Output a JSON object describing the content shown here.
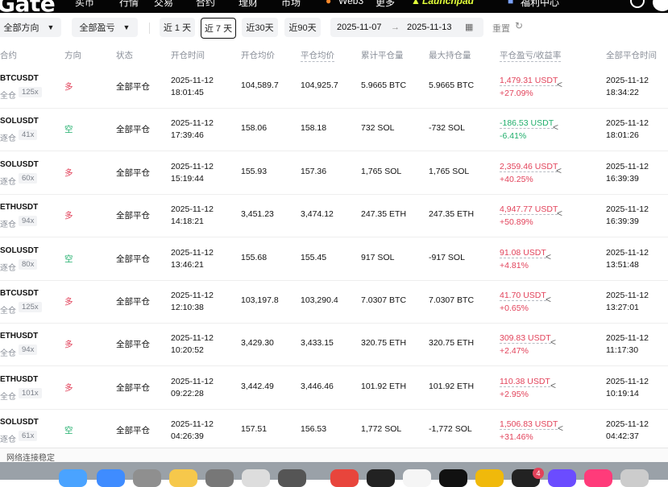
{
  "nav": {
    "logo": "Gate",
    "items": [
      "买币",
      "行情",
      "交易",
      "合约",
      "理财",
      "市场",
      "Web3",
      "更多",
      "Launchpad",
      "福利中心"
    ],
    "fire_icon": "fire-icon",
    "launchpad_icon": "rocket-icon",
    "welfare_icon": "gift-icon"
  },
  "filters": {
    "direction": "全部方向",
    "pnl": "全部盈亏",
    "periods": [
      "近 1 天",
      "近 7 天",
      "近30天",
      "近90天"
    ],
    "selected_period": "近 7 天",
    "start_date": "2025-11-07",
    "end_date": "2025-11-13",
    "reset": "重置"
  },
  "columns": [
    "合约",
    "方向",
    "状态",
    "开仓时间",
    "开仓均价",
    "平仓均价",
    "累计平仓量",
    "最大持仓量",
    "平仓盈亏/收益率",
    "全部平仓时间"
  ],
  "rows": [
    {
      "symbol": "BTCUSDT",
      "mode": "全仓",
      "leverage": "125x",
      "direction": "多",
      "side": "long",
      "status": "全部平仓",
      "open_date": "2025-11-12",
      "open_time": "18:01:45",
      "open_price": "104,589.7",
      "close_price": "104,925.7",
      "closed_qty": "5.9665 BTC",
      "max_pos": "5.9665 BTC",
      "pnl": "1,479.31 USDT",
      "pct": "+27.09%",
      "close_date": "2025-11-12",
      "close_time": "18:34:22"
    },
    {
      "symbol": "SOLUSDT",
      "mode": "逐仓",
      "leverage": "41x",
      "direction": "空",
      "side": "short",
      "status": "全部平仓",
      "open_date": "2025-11-12",
      "open_time": "17:39:46",
      "open_price": "158.06",
      "close_price": "158.18",
      "closed_qty": "732 SOL",
      "max_pos": "-732 SOL",
      "pnl": "-186.53 USDT",
      "pct": "-6.41%",
      "close_date": "2025-11-12",
      "close_time": "18:01:26"
    },
    {
      "symbol": "SOLUSDT",
      "mode": "逐仓",
      "leverage": "60x",
      "direction": "多",
      "side": "long",
      "status": "全部平仓",
      "open_date": "2025-11-12",
      "open_time": "15:19:44",
      "open_price": "155.93",
      "close_price": "157.36",
      "closed_qty": "1,765 SOL",
      "max_pos": "1,765 SOL",
      "pnl": "2,359.46 USDT",
      "pct": "+40.25%",
      "close_date": "2025-11-12",
      "close_time": "16:39:39"
    },
    {
      "symbol": "ETHUSDT",
      "mode": "逐仓",
      "leverage": "94x",
      "direction": "多",
      "side": "long",
      "status": "全部平仓",
      "open_date": "2025-11-12",
      "open_time": "14:18:21",
      "open_price": "3,451.23",
      "close_price": "3,474.12",
      "closed_qty": "247.35 ETH",
      "max_pos": "247.35 ETH",
      "pnl": "4,947.77 USDT",
      "pct": "+50.89%",
      "close_date": "2025-11-12",
      "close_time": "16:39:39"
    },
    {
      "symbol": "SOLUSDT",
      "mode": "逐仓",
      "leverage": "80x",
      "direction": "空",
      "side": "short",
      "status": "全部平仓",
      "open_date": "2025-11-12",
      "open_time": "13:46:21",
      "open_price": "155.68",
      "close_price": "155.45",
      "closed_qty": "917 SOL",
      "max_pos": "-917 SOL",
      "pnl": "91.08 USDT",
      "pct": "+4.81%",
      "close_date": "2025-11-12",
      "close_time": "13:51:48"
    },
    {
      "symbol": "BTCUSDT",
      "mode": "全仓",
      "leverage": "125x",
      "direction": "多",
      "side": "long",
      "status": "全部平仓",
      "open_date": "2025-11-12",
      "open_time": "12:10:38",
      "open_price": "103,197.8",
      "close_price": "103,290.4",
      "closed_qty": "7.0307 BTC",
      "max_pos": "7.0307 BTC",
      "pnl": "41.70 USDT",
      "pct": "+0.65%",
      "close_date": "2025-11-12",
      "close_time": "13:27:01"
    },
    {
      "symbol": "ETHUSDT",
      "mode": "全仓",
      "leverage": "94x",
      "direction": "多",
      "side": "long",
      "status": "全部平仓",
      "open_date": "2025-11-12",
      "open_time": "10:20:52",
      "open_price": "3,429.30",
      "close_price": "3,433.15",
      "closed_qty": "320.75 ETH",
      "max_pos": "320.75 ETH",
      "pnl": "309.83 USDT",
      "pct": "+2.47%",
      "close_date": "2025-11-12",
      "close_time": "11:17:30"
    },
    {
      "symbol": "ETHUSDT",
      "mode": "全仓",
      "leverage": "101x",
      "direction": "多",
      "side": "long",
      "status": "全部平仓",
      "open_date": "2025-11-12",
      "open_time": "09:22:28",
      "open_price": "3,442.49",
      "close_price": "3,446.46",
      "closed_qty": "101.92 ETH",
      "max_pos": "101.92 ETH",
      "pnl": "110.38 USDT",
      "pct": "+2.95%",
      "close_date": "2025-11-12",
      "close_time": "10:19:14"
    },
    {
      "symbol": "SOLUSDT",
      "mode": "逐仓",
      "leverage": "61x",
      "direction": "空",
      "side": "short",
      "status": "全部平仓",
      "open_date": "2025-11-12",
      "open_time": "04:26:39",
      "open_price": "157.51",
      "close_price": "156.53",
      "closed_qty": "1,772 SOL",
      "max_pos": "-1,772 SOL",
      "pnl": "1,506.83 USDT",
      "pct": "+31.46%",
      "close_date": "2025-11-12",
      "close_time": "04:42:37"
    }
  ],
  "status_bar": "网络连接稳定",
  "dock": {
    "apps": [
      "finder-icon",
      "safari-icon",
      "launchpad-icon",
      "notes-icon",
      "settings-icon",
      "chrome-icon",
      "system-icon",
      "app-red-icon",
      "app-dark-icon",
      "app-white-icon",
      "app-dark2-icon",
      "binance-icon",
      "app-badge-icon",
      "app-purple-icon",
      "app-pink-icon",
      "app-gray-icon"
    ],
    "badge_count": "4"
  },
  "colors": {
    "long": "#e2425a",
    "short": "#1fae6b",
    "muted": "#8a8f99"
  }
}
